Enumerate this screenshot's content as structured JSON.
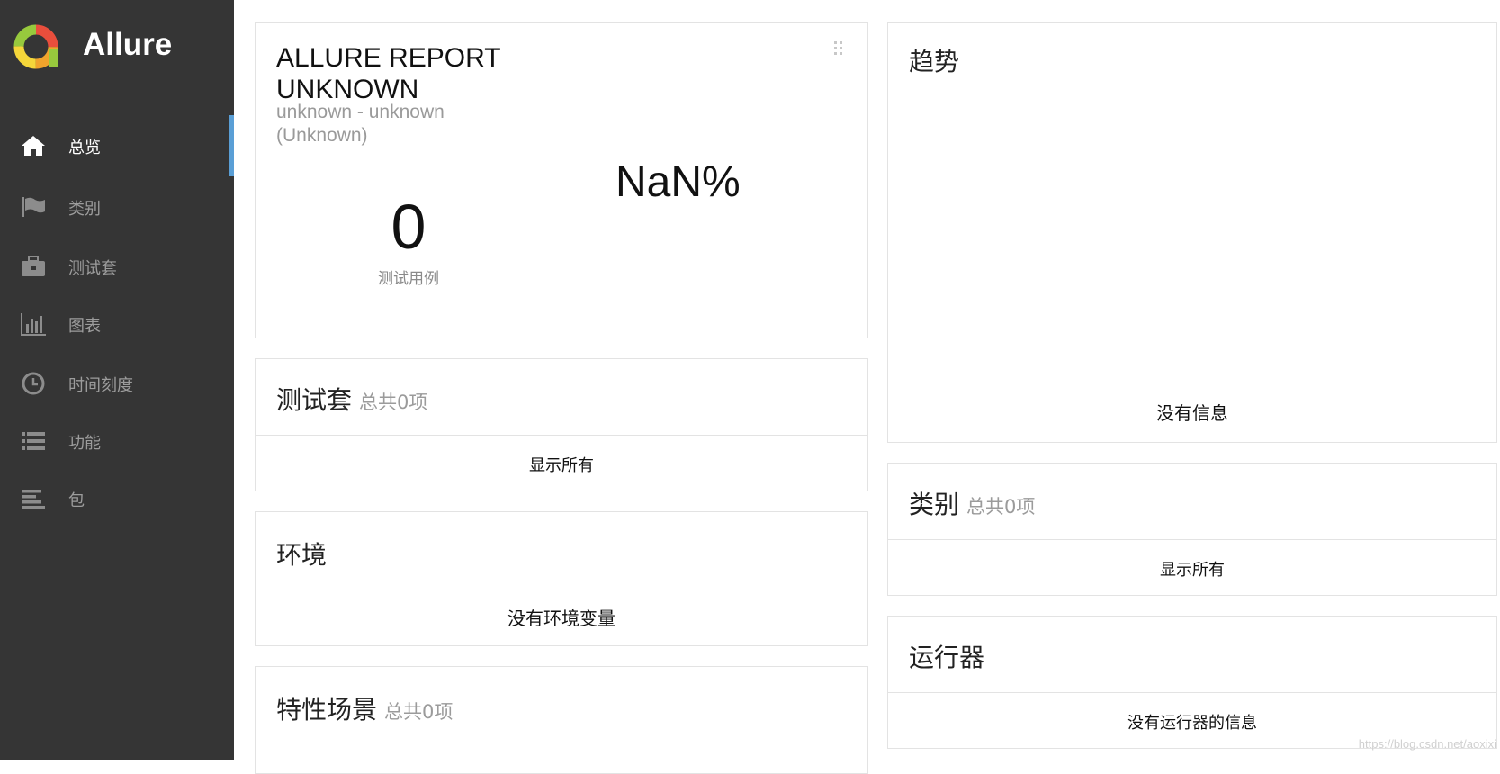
{
  "app": {
    "name": "Allure"
  },
  "sidebar": {
    "items": [
      {
        "label": "总览",
        "icon": "home-icon",
        "active": true
      },
      {
        "label": "类别",
        "icon": "flag-icon"
      },
      {
        "label": "测试套",
        "icon": "briefcase-icon"
      },
      {
        "label": "图表",
        "icon": "bar-chart-icon"
      },
      {
        "label": "时间刻度",
        "icon": "clock-icon"
      },
      {
        "label": "功能",
        "icon": "list-icon"
      },
      {
        "label": "包",
        "icon": "align-left-icon"
      }
    ]
  },
  "report": {
    "title": "ALLURE REPORT UNKNOWN",
    "subtitle": "unknown - unknown (Unknown)",
    "test_count": "0",
    "test_count_label": "测试用例",
    "percent": "NaN%"
  },
  "suites": {
    "title": "测试套",
    "count_text": "总共0项",
    "show_all": "显示所有"
  },
  "environment": {
    "title": "环境",
    "empty_text": "没有环境变量"
  },
  "features": {
    "title": "特性场景",
    "count_text": "总共0项"
  },
  "trend": {
    "title": "趋势",
    "empty_text": "没有信息"
  },
  "categories": {
    "title": "类别",
    "count_text": "总共0项",
    "show_all": "显示所有"
  },
  "executors": {
    "title": "运行器",
    "empty_text": "没有运行器的信息"
  },
  "watermark": "https://blog.csdn.net/aoxixi",
  "colors": {
    "sidebar_bg": "#353535",
    "active_indicator": "#5a9fd6"
  }
}
